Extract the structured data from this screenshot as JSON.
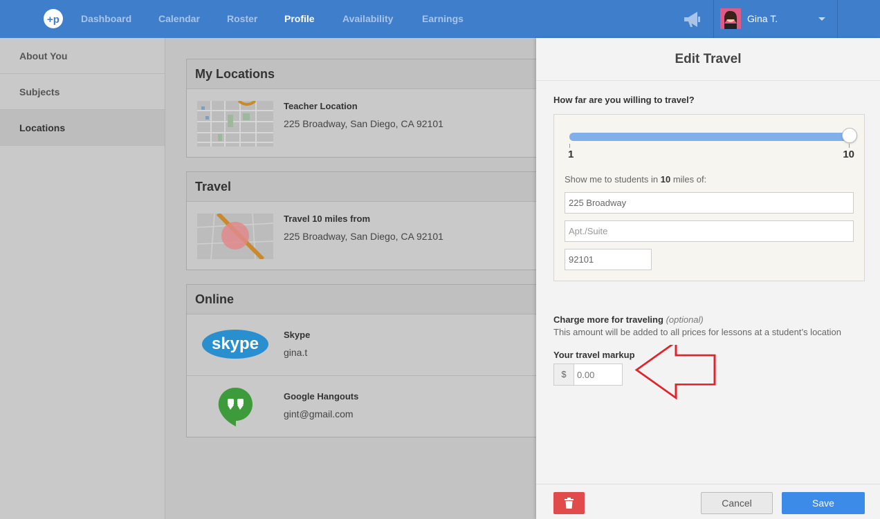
{
  "nav": {
    "items": [
      {
        "label": "Dashboard"
      },
      {
        "label": "Calendar"
      },
      {
        "label": "Roster"
      },
      {
        "label": "Profile"
      },
      {
        "label": "Availability"
      },
      {
        "label": "Earnings"
      }
    ],
    "active": "Profile",
    "user_name": "Gina T.",
    "logo_icon": "logo-icon",
    "notification_icon": "megaphone-icon",
    "brand_color": "#3f7ecb"
  },
  "sidebar": {
    "items": [
      {
        "label": "About You"
      },
      {
        "label": "Subjects"
      },
      {
        "label": "Locations"
      }
    ],
    "active": "Locations"
  },
  "main": {
    "my_locations": {
      "title": "My Locations",
      "rows": [
        {
          "title": "Teacher Location",
          "subtitle": "225 Broadway, San Diego, CA 92101"
        }
      ]
    },
    "travel": {
      "title": "Travel",
      "rows": [
        {
          "title": "Travel 10 miles from",
          "subtitle": "225 Broadway, San Diego, CA 92101"
        }
      ]
    },
    "online": {
      "title": "Online",
      "rows": [
        {
          "title": "Skype",
          "subtitle": "gina.t",
          "icon": "skype-icon"
        },
        {
          "title": "Google Hangouts",
          "subtitle": "gint@gmail.com",
          "icon": "hangouts-icon"
        }
      ]
    }
  },
  "drawer": {
    "title": "Edit Travel",
    "question": "How far are you willing to travel?",
    "slider": {
      "min": "1",
      "max": "10",
      "value": 10
    },
    "show_prefix": "Show me to students in ",
    "show_value": "10",
    "show_suffix": " miles of:",
    "fields": {
      "street": {
        "value": "225 Broadway",
        "placeholder": ""
      },
      "apt": {
        "value": "",
        "placeholder": "Apt./Suite"
      },
      "zip": {
        "value": "92101",
        "placeholder": ""
      }
    },
    "charge_title": "Charge more for traveling",
    "charge_optional": "(optional)",
    "charge_desc": "This amount will be added to all prices for lessons at a student’s location",
    "markup_label": "Your travel markup",
    "markup_prefix": "$",
    "markup_placeholder": "0.00",
    "markup_value": "",
    "cancel_label": "Cancel",
    "save_label": "Save",
    "delete_icon": "trash-icon",
    "save_color": "#3d8be8",
    "delete_color": "#e14b4b",
    "annotation_arrow_color": "#e0242b"
  }
}
